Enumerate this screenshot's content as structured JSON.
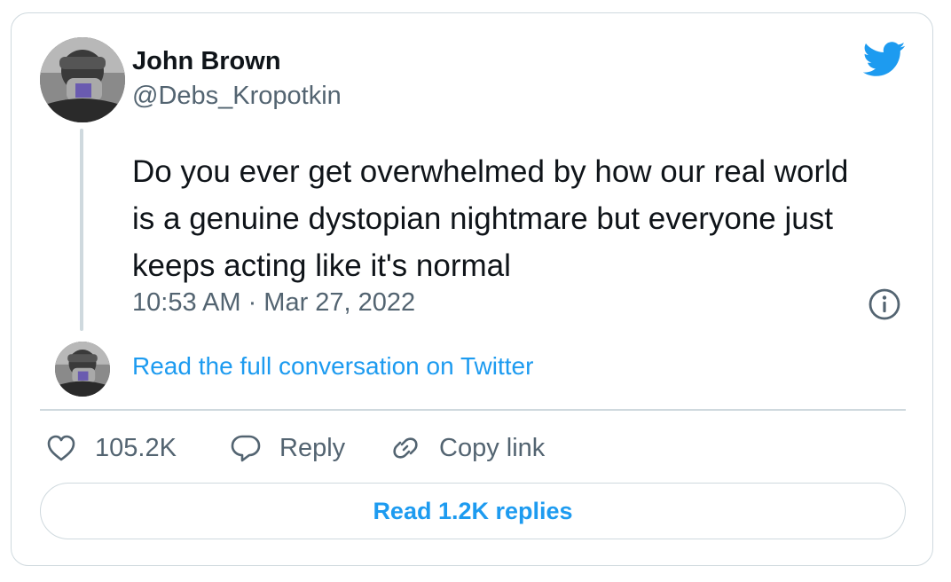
{
  "author": {
    "name": "John Brown",
    "handle": "@Debs_Kropotkin"
  },
  "tweet": {
    "text": "Do you ever get overwhelmed by how our real world is a genuine dystopian nightmare but everyone just keeps acting like it's normal",
    "timestamp": "10:53 AM · Mar 27, 2022"
  },
  "conversation_link": "Read the full conversation on Twitter",
  "actions": {
    "like_count": "105.2K",
    "reply_label": "Reply",
    "copy_link_label": "Copy link"
  },
  "read_replies_label": "Read 1.2K replies",
  "colors": {
    "accent": "#1d9bf0",
    "secondary_text": "#536471",
    "border": "#cfd9de"
  },
  "icons": [
    "twitter-bird-icon",
    "info-icon",
    "heart-icon",
    "reply-bubble-icon",
    "link-icon"
  ]
}
